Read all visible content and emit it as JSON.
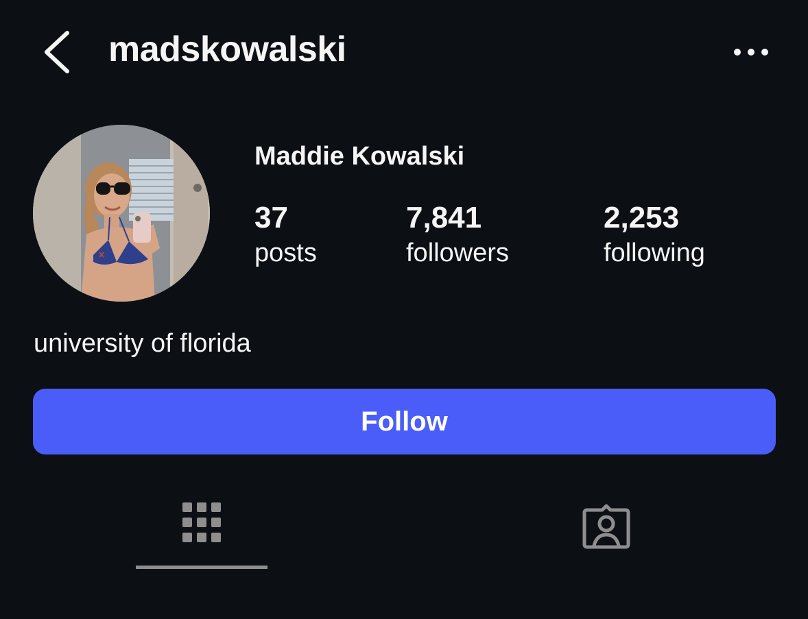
{
  "header": {
    "username": "madskowalski",
    "back_icon": "chevron-left-icon",
    "more_icon": "more-horizontal-icon"
  },
  "profile": {
    "display_name": "Maddie Kowalski",
    "avatar": "profile-photo",
    "stats": {
      "posts": {
        "count": "37",
        "label": "posts"
      },
      "followers": {
        "count": "7,841",
        "label": "followers"
      },
      "following": {
        "count": "2,253",
        "label": "following"
      }
    },
    "bio": "university of florida"
  },
  "actions": {
    "follow_label": "Follow",
    "follow_color": "#4a5df9"
  },
  "tabs": [
    {
      "name": "posts-grid",
      "icon": "grid-icon",
      "active": true
    },
    {
      "name": "tagged",
      "icon": "tagged-person-icon",
      "active": false
    }
  ],
  "colors": {
    "background": "#0c1014",
    "text": "#f5f5f5",
    "muted_icon": "#8e8e8e"
  }
}
